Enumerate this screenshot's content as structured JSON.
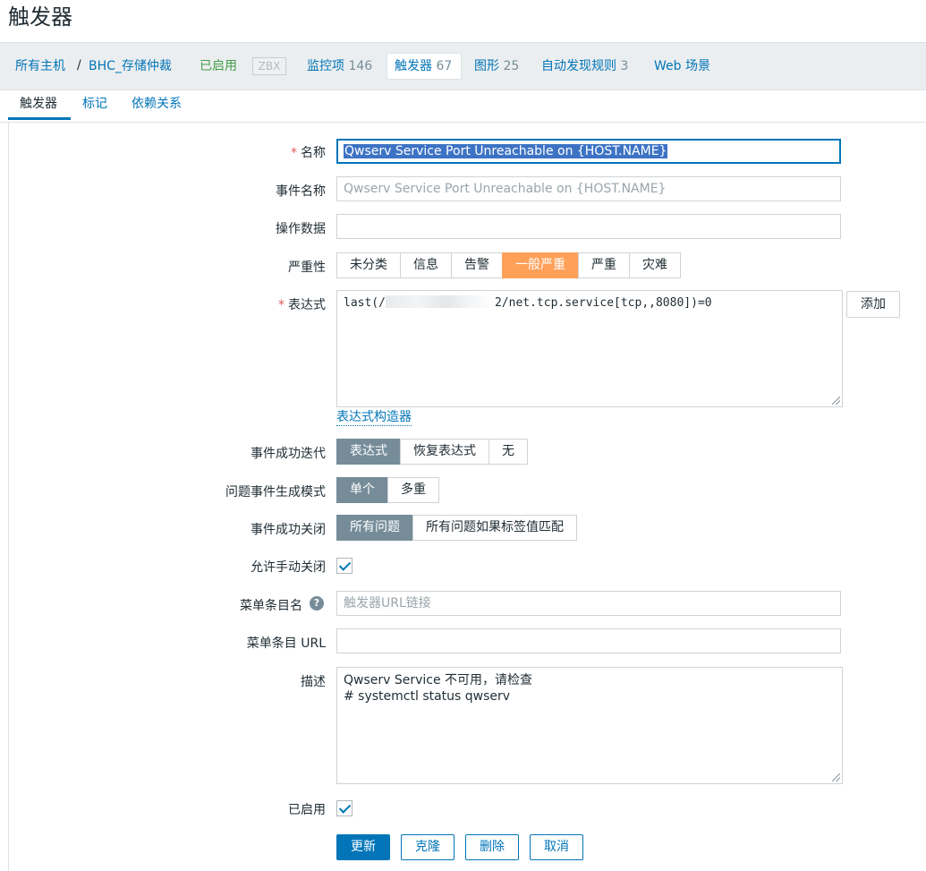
{
  "page_title": "触发器",
  "host_nav": {
    "all_hosts": "所有主机",
    "separator": "/",
    "host_name": "BHC_存储仲裁",
    "enabled_label": "已启用",
    "zbx_badge": "ZBX",
    "items_label": "监控项",
    "items_count": "146",
    "triggers_label": "触发器",
    "triggers_count": "67",
    "graphs_label": "图形",
    "graphs_count": "25",
    "discovery_label": "自动发现规则",
    "discovery_count": "3",
    "web_label": "Web 场景"
  },
  "subtabs": [
    "触发器",
    "标记",
    "依赖关系"
  ],
  "form": {
    "name_label": "名称",
    "name_value": "Qwserv Service Port Unreachable on {HOST.NAME}",
    "event_name_label": "事件名称",
    "event_name_placeholder": "Qwserv Service Port Unreachable on {HOST.NAME}",
    "opdata_label": "操作数据",
    "opdata_value": "",
    "severity_label": "严重性",
    "severity_options": [
      "未分类",
      "信息",
      "告警",
      "一般严重",
      "严重",
      "灾难"
    ],
    "severity_selected": "一般严重",
    "expression_label": "表达式",
    "expression_prefix": "last(/",
    "expression_suffix": "2/net.tcp.service[tcp,,8080])=0",
    "add_button": "添加",
    "expression_builder": "表达式构造器",
    "ok_event_label": "事件成功迭代",
    "ok_event_options": [
      "表达式",
      "恢复表达式",
      "无"
    ],
    "ok_event_selected": "表达式",
    "problem_mode_label": "问题事件生成模式",
    "problem_mode_options": [
      "单个",
      "多重"
    ],
    "problem_mode_selected": "单个",
    "ok_close_label": "事件成功关闭",
    "ok_close_options": [
      "所有问题",
      "所有问题如果标签值匹配"
    ],
    "ok_close_selected": "所有问题",
    "manual_close_label": "允许手动关闭",
    "manual_close_checked": true,
    "url_name_label": "菜单条目名",
    "url_name_placeholder": "触发器URL链接",
    "help_glyph": "?",
    "url_label": "菜单条目 URL",
    "url_value": "",
    "description_label": "描述",
    "description_line1": "Qwserv Service 不可用，请检查",
    "description_line2": "# systemctl status qwserv",
    "enabled_label": "已启用",
    "enabled_checked": true
  },
  "buttons": {
    "update": "更新",
    "clone": "克隆",
    "delete": "删除",
    "cancel": "取消"
  },
  "colors": {
    "link": "#0275b8",
    "severity_average": "#ffa059",
    "segment_selected": "#768d99",
    "enabled_green": "#429e47"
  }
}
